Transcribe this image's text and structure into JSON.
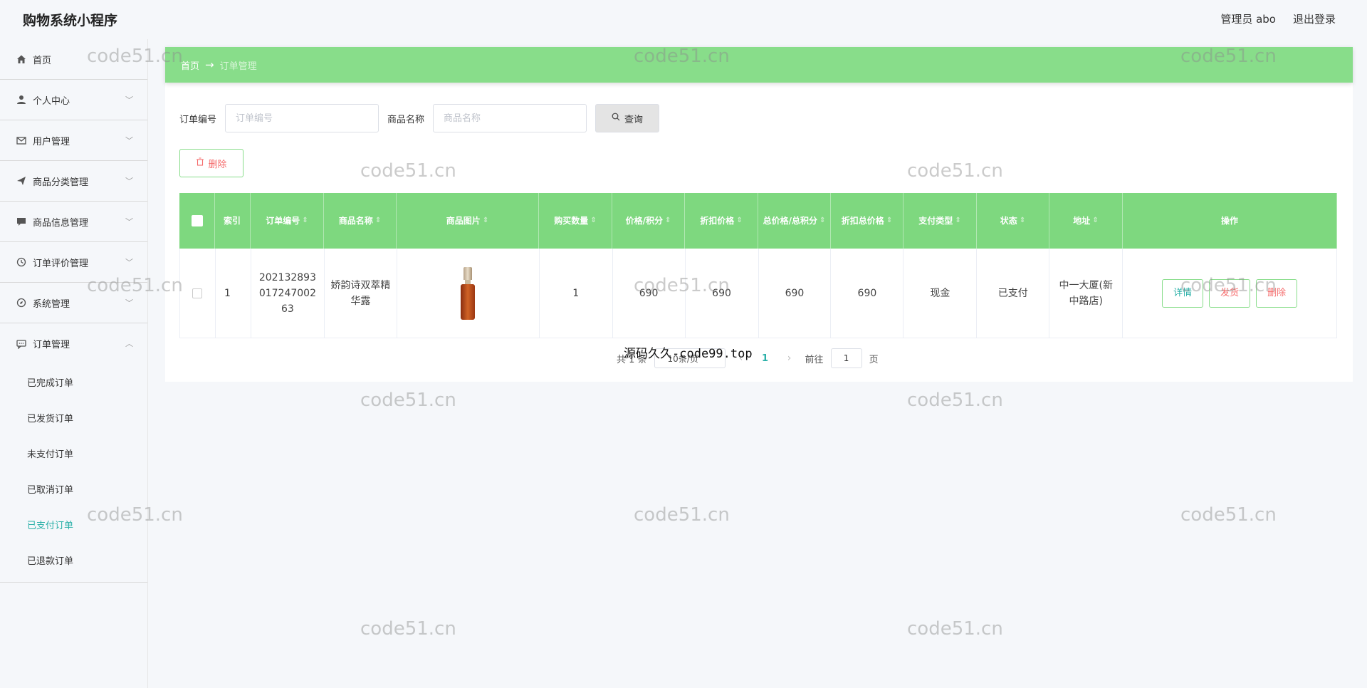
{
  "app": {
    "title": "购物系统小程序",
    "admin_label": "管理员 abo",
    "logout_label": "退出登录"
  },
  "sidebar": {
    "items": [
      {
        "label": "首页",
        "icon": "home-icon",
        "has_chevron": false
      },
      {
        "label": "个人中心",
        "icon": "user-icon",
        "has_chevron": true
      },
      {
        "label": "用户管理",
        "icon": "mail-icon",
        "has_chevron": true
      },
      {
        "label": "商品分类管理",
        "icon": "send-icon",
        "has_chevron": true
      },
      {
        "label": "商品信息管理",
        "icon": "message-icon",
        "has_chevron": true
      },
      {
        "label": "订单评价管理",
        "icon": "clock-icon",
        "has_chevron": true
      },
      {
        "label": "系统管理",
        "icon": "compass-icon",
        "has_chevron": true
      },
      {
        "label": "订单管理",
        "icon": "chat-icon",
        "has_chevron": true,
        "expanded": true
      }
    ],
    "sub_items": [
      {
        "label": "已完成订单",
        "active": false
      },
      {
        "label": "已发货订单",
        "active": false
      },
      {
        "label": "未支付订单",
        "active": false
      },
      {
        "label": "已取消订单",
        "active": false
      },
      {
        "label": "已支付订单",
        "active": true
      },
      {
        "label": "已退款订单",
        "active": false
      }
    ]
  },
  "breadcrumb": {
    "home": "首页",
    "arrow": "→",
    "current": "订单管理"
  },
  "search": {
    "order_no_label": "订单编号",
    "order_no_placeholder": "订单编号",
    "product_name_label": "商品名称",
    "product_name_placeholder": "商品名称",
    "query_label": "查询"
  },
  "actions": {
    "delete_label": "删除"
  },
  "table": {
    "headers": [
      "",
      "索引",
      "订单编号",
      "商品名称",
      "商品图片",
      "购买数量",
      "价格/积分",
      "折扣价格",
      "总价格/总积分",
      "折扣总价格",
      "支付类型",
      "状态",
      "地址",
      "操作"
    ],
    "rows": [
      {
        "index": "1",
        "order_no": "202132893017247002 63",
        "product_name": "娇韵诗双萃精华露",
        "quantity": "1",
        "price": "690",
        "discount_price": "690",
        "total_price": "690",
        "discount_total": "690",
        "pay_type": "现金",
        "status": "已支付",
        "address": "中一大厦(新中路店)",
        "ops": {
          "detail": "详情",
          "ship": "发货",
          "delete": "删除"
        }
      }
    ]
  },
  "pagination": {
    "total_text": "共 1 条",
    "page_size": "10条/页",
    "current_page": "1",
    "goto_label": "前往",
    "goto_value": "1",
    "page_suffix": "页"
  },
  "overlay_text": "源码久久-code99.top",
  "watermark": "code51.cn",
  "colors": {
    "header_green": "#88dd8a",
    "table_header_green": "#7ed87f",
    "accent_teal": "#2ab0a8",
    "danger_red": "#f56c6c"
  }
}
